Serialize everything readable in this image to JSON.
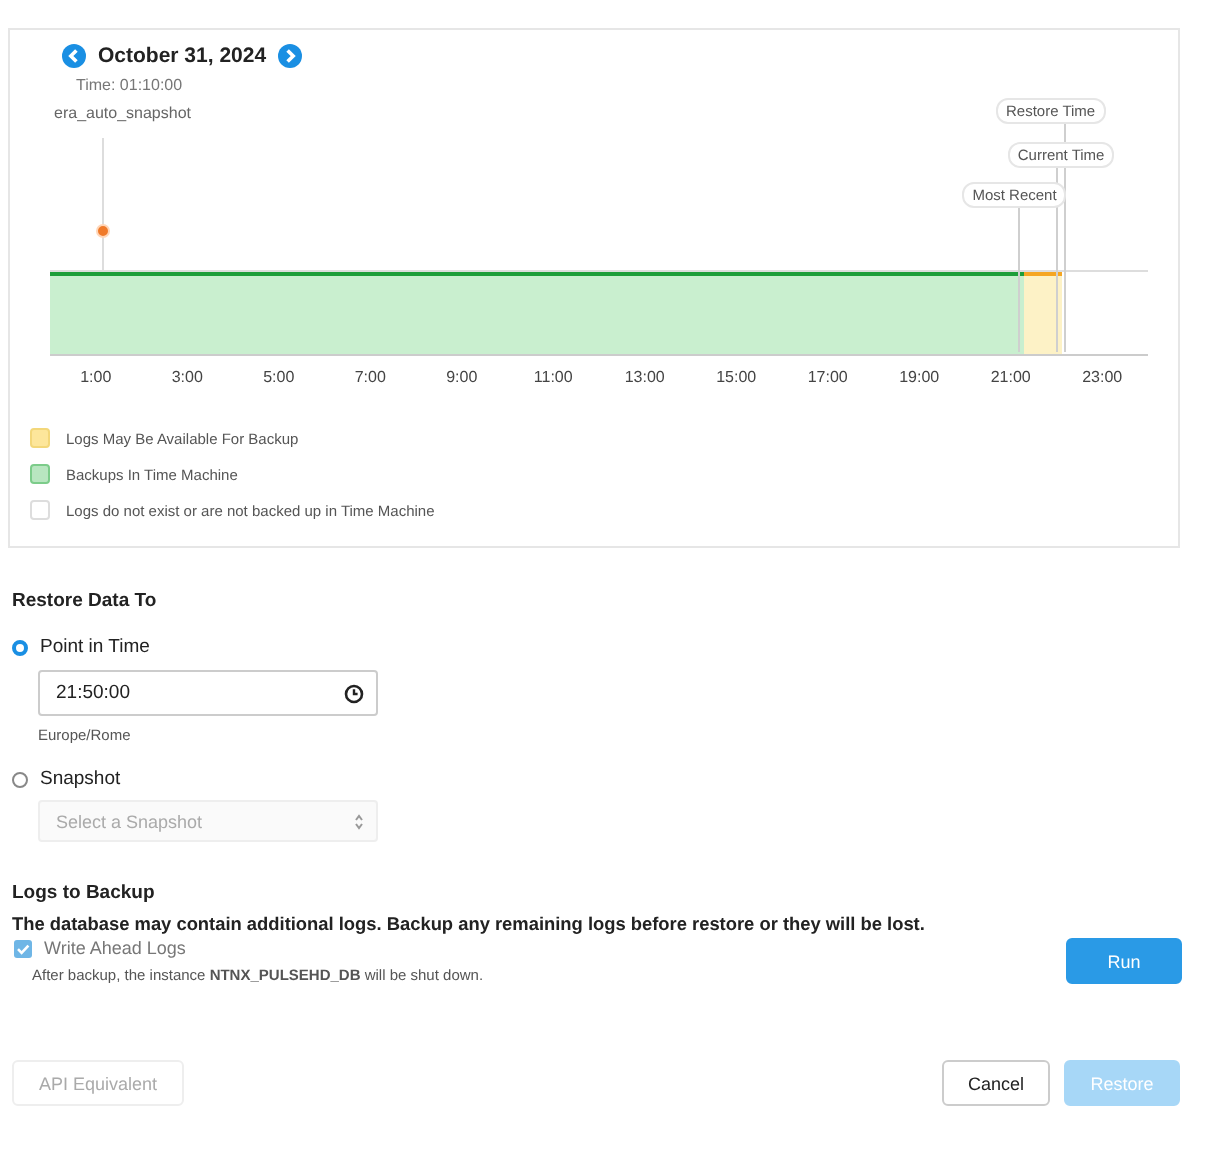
{
  "calendar": {
    "date": "October 31, 2024",
    "snapshot_tooltip": {
      "time": "Time: 01:10:00",
      "name": "era_auto_snapshot"
    }
  },
  "timeline": {
    "markers": [
      {
        "kind": "restore",
        "label": "Restore Time"
      },
      {
        "kind": "current",
        "label": "Current Time"
      },
      {
        "kind": "recent",
        "label": "Most Recent"
      }
    ],
    "axis_labels": [
      "1:00",
      "3:00",
      "5:00",
      "7:00",
      "9:00",
      "11:00",
      "13:00",
      "15:00",
      "17:00",
      "19:00",
      "21:00",
      "23:00"
    ]
  },
  "legend": [
    {
      "kind": "logs",
      "label": "Logs May Be Available For Backup"
    },
    {
      "kind": "backups",
      "label": "Backups In Time Machine"
    },
    {
      "kind": "none",
      "label": "Logs do not exist or are not backed up in Time Machine"
    }
  ],
  "restore_data_to": {
    "title": "Restore Data To",
    "options": [
      {
        "kind": "time",
        "label": "Point in Time",
        "selected": true
      },
      {
        "kind": "snapshot",
        "label": "Snapshot",
        "selected": false
      }
    ],
    "time_field": {
      "value": "21:50:00",
      "timezone": "Europe/Rome"
    },
    "snapshot_select": {
      "placeholder": "Select a Snapshot",
      "disabled": true
    }
  },
  "logs_to_backup": {
    "title": "Logs to Backup",
    "message": "The database may contain additional logs. Backup any remaining logs before restore or they will be lost.",
    "option": {
      "label": "Write Ahead Logs",
      "checked": true
    },
    "note": "After backup, the instance **NTNX_PULSEHD_DB** will be shut down.",
    "run_button": "Run"
  },
  "footer": {
    "api_button": "API Equivalent",
    "cancel_button": "Cancel",
    "restore_button": {
      "label": "Restore",
      "disabled": true
    }
  }
}
